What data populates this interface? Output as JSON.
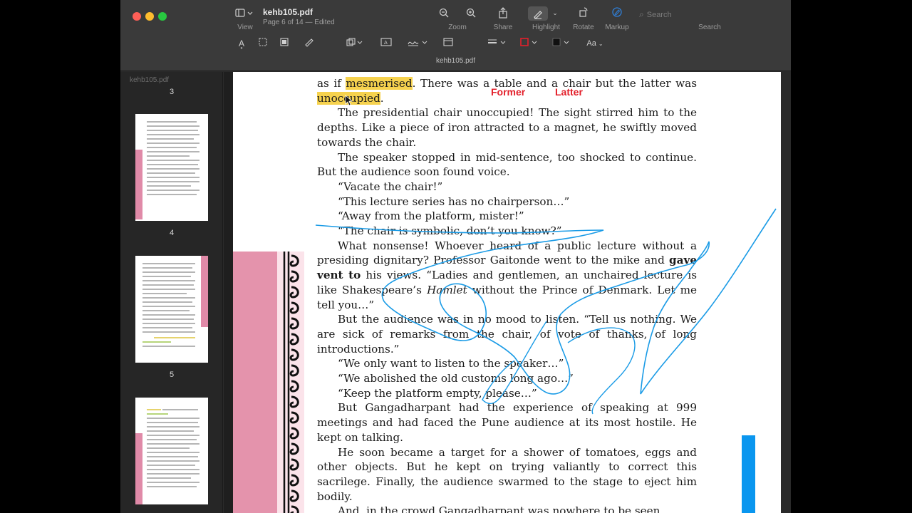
{
  "window": {
    "filename": "kehb105.pdf",
    "subtitle": "Page 6 of 14 — Edited",
    "tab_title": "kehb105.pdf"
  },
  "toolbar": {
    "view_label": "View",
    "zoom_label": "Zoom",
    "share_label": "Share",
    "highlight_label": "Highlight",
    "rotate_label": "Rotate",
    "markup_label": "Markup",
    "search_label": "Search",
    "search_placeholder": "Search",
    "font_button": "Aa"
  },
  "sidebar": {
    "file_label": "kehb105.pdf",
    "pages": [
      "3",
      "4",
      "5"
    ]
  },
  "annotations": {
    "former": "Former",
    "latter": "Latter"
  },
  "document": {
    "p1_a": "as if ",
    "p1_hl1": "mesmerised",
    "p1_b": ". There was a table and a chair but the latter was ",
    "p1_hl2": "unoccupied",
    "p1_c": ".",
    "p2": "The presidential chair unoccupied! The sight stirred him to the depths. Like a piece of iron attracted to a magnet, he swiftly moved towards the chair.",
    "p3": "The speaker stopped in mid-sentence, too shocked to continue. But the audience soon found voice.",
    "q1": "“Vacate the chair!”",
    "q2": "“This lecture series has no chairperson…”",
    "q3": "“Away from the platform, mister!”",
    "q4": "“The chair is symbolic, don’t you know?”",
    "p4_a": "What nonsense! Whoever heard of a public lecture without a presiding dignitary? Professor Gaitonde went to the mike and ",
    "p4_bold": "gave vent to",
    "p4_b": " his views. “Ladies and gentlemen, an unchaired lecture is like Shakespeare’s ",
    "p4_ital": "Hamlet",
    "p4_c": " without the Prince of Denmark. Let me tell you…”",
    "p5": "But the audience was in no mood to listen. “Tell us nothing. We are sick of remarks from the chair, of vote of thanks, of long introductions.”",
    "q5": "“We only want to listen to the speaker…”",
    "q6": "“We abolished the old customs long ago…”",
    "q7": "“Keep the platform empty, please…”",
    "p6": "But Gangadharpant had the experience of speaking at 999 meetings and had faced the Pune audience at its most hostile. He kept on talking.",
    "p7": "He soon became a target for a shower of tomatoes, eggs and other objects. But he kept on trying valiantly to correct this sacrilege. Finally, the audience swarmed to the stage to eject him bodily.",
    "p8": "And, in the crowd Gangadharpant was nowhere to be seen."
  },
  "colors": {
    "highlight": "#f6d24e",
    "annotation_red": "#e3202b",
    "ink_blue": "#1a9be6",
    "page_pink": "#e493ac"
  }
}
